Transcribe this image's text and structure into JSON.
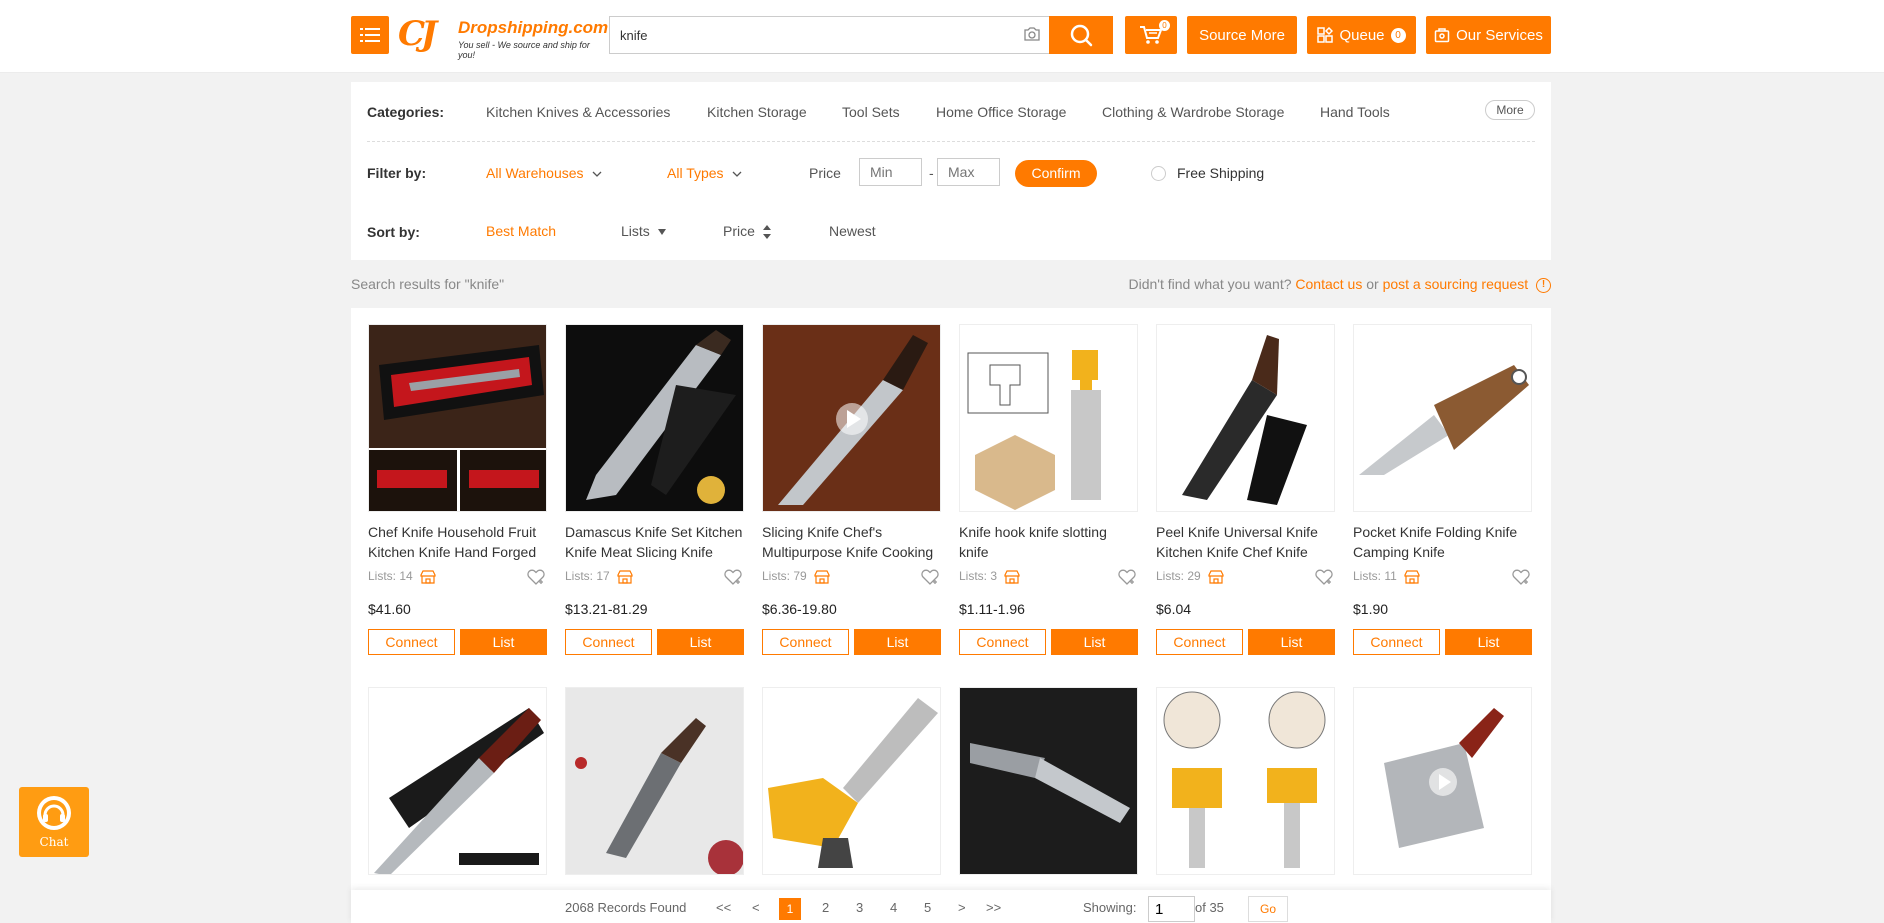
{
  "header": {
    "logo_name": "Dropshipping.com",
    "logo_tagline": "You sell - We source and ship for you!",
    "search_value": "knife",
    "cart_count": "0",
    "source_more": "Source More",
    "queue_label": "Queue",
    "queue_count": "0",
    "our_services": "Our Services",
    "accent_color": "#ff7a00"
  },
  "filters": {
    "categories_label": "Categories:",
    "categories": [
      "Kitchen Knives & Accessories",
      "Kitchen Storage",
      "Tool Sets",
      "Home Office Storage",
      "Clothing & Wardrobe Storage",
      "Hand Tools"
    ],
    "more_label": "More",
    "filter_by_label": "Filter by:",
    "warehouses": "All Warehouses",
    "types": "All Types",
    "price_label": "Price",
    "min_placeholder": "Min",
    "max_placeholder": "Max",
    "confirm": "Confirm",
    "free_shipping": "Free Shipping",
    "sort_by_label": "Sort by:",
    "sort_options": [
      "Best Match",
      "Lists",
      "Price",
      "Newest"
    ]
  },
  "results": {
    "summary": "Search results for \"knife\"",
    "not_found": "Didn't find what you want?",
    "contact_us": "Contact us",
    "or": "or",
    "sourcing_request": "post a sourcing request"
  },
  "products": [
    {
      "title": "Chef Knife Household Fruit Kitchen Knife Hand Forged",
      "lists": "Lists: 14",
      "price": "$41.60",
      "image": "knife-in-black-gift-box"
    },
    {
      "title": "Damascus Knife Set Kitchen Knife Meat Slicing Knife",
      "lists": "Lists: 17",
      "price": "$13.21-81.29",
      "image": "santoku-knife-with-sheath"
    },
    {
      "title": "Slicing Knife Chef's Multipurpose Knife Cooking Knife",
      "lists": "Lists: 79",
      "price": "$6.36-19.80",
      "image": "chef-knife-on-wood-video"
    },
    {
      "title": "Knife hook knife slotting knife",
      "lists": "Lists: 3",
      "price": "$1.11-1.96",
      "image": "router-bit-diagram"
    },
    {
      "title": "Peel Knife Universal Knife Kitchen Knife Chef Knife",
      "lists": "Lists: 29",
      "price": "$6.04",
      "image": "black-chef-knife"
    },
    {
      "title": "Pocket Knife Folding Knife Camping Knife",
      "lists": "Lists: 11",
      "price": "$1.90",
      "image": "folding-pocket-knife"
    },
    {
      "image": "chef-knife-with-box"
    },
    {
      "image": "santoku-knife-with-meat"
    },
    {
      "image": "yellow-router-bit"
    },
    {
      "image": "folding-knife-dark"
    },
    {
      "image": "router-bit-profiles"
    },
    {
      "image": "cleaver-knife"
    }
  ],
  "buttons": {
    "connect": "Connect",
    "list": "List"
  },
  "pagination": {
    "records": "2068 Records Found",
    "first": "<<",
    "prev": "<",
    "pages": [
      "1",
      "2",
      "3",
      "4",
      "5"
    ],
    "next": ">",
    "last": ">>",
    "showing": "Showing:",
    "current": "1",
    "of_total": "of 35",
    "go": "Go"
  },
  "chat": {
    "label": "Chat"
  }
}
